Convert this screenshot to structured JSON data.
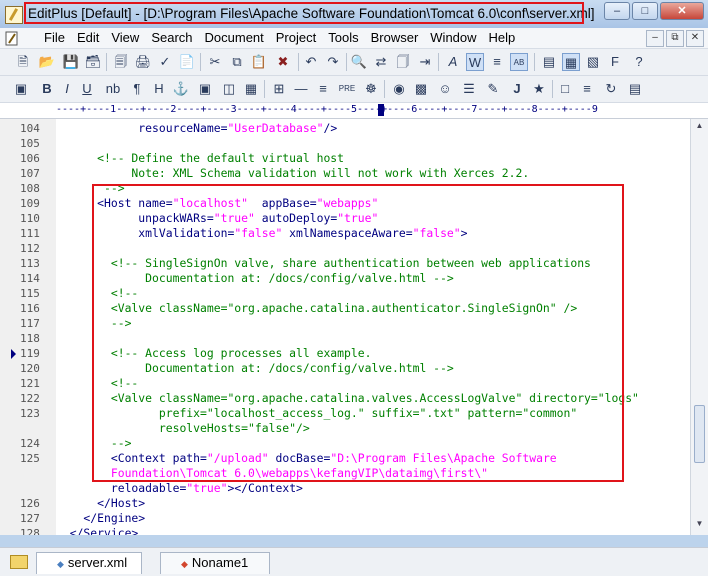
{
  "window": {
    "title": "EditPlus [Default] - [D:\\Program Files\\Apache Software Foundation\\Tomcat 6.0\\conf\\server.xml]"
  },
  "menu": [
    "File",
    "Edit",
    "View",
    "Search",
    "Document",
    "Project",
    "Tools",
    "Browser",
    "Window",
    "Help"
  ],
  "toolbar2": {
    "text_labels": [
      "B",
      "I",
      "U",
      "nb",
      "¶",
      "H",
      "J"
    ]
  },
  "ruler": "----+----1----+----2----+----3----+----4----+----5----+----6----+----7----+----8----+----9",
  "editor": {
    "lines": [
      {
        "n": "104",
        "parts": [
          {
            "t": "            ",
            "c": "txt"
          },
          {
            "t": "resourceName=",
            "c": "tag"
          },
          {
            "t": "\"UserDatabase\"",
            "c": "str"
          },
          {
            "t": "/>",
            "c": "tag"
          }
        ]
      },
      {
        "n": "105",
        "parts": []
      },
      {
        "n": "106",
        "parts": [
          {
            "t": "      <!-- Define the default virtual host",
            "c": "cm"
          }
        ]
      },
      {
        "n": "107",
        "parts": [
          {
            "t": "           Note: XML Schema validation will not work with Xerces 2.2.",
            "c": "cm"
          }
        ]
      },
      {
        "n": "108",
        "parts": [
          {
            "t": "       -->",
            "c": "cm"
          }
        ]
      },
      {
        "n": "109",
        "parts": [
          {
            "t": "      <Host ",
            "c": "tag"
          },
          {
            "t": "name=",
            "c": "tag"
          },
          {
            "t": "\"localhost\"",
            "c": "str"
          },
          {
            "t": "  appBase=",
            "c": "tag"
          },
          {
            "t": "\"webapps\"",
            "c": "str"
          }
        ]
      },
      {
        "n": "110",
        "parts": [
          {
            "t": "            unpackWARs=",
            "c": "tag"
          },
          {
            "t": "\"true\"",
            "c": "str"
          },
          {
            "t": " autoDeploy=",
            "c": "tag"
          },
          {
            "t": "\"true\"",
            "c": "str"
          }
        ]
      },
      {
        "n": "111",
        "parts": [
          {
            "t": "            xmlValidation=",
            "c": "tag"
          },
          {
            "t": "\"false\"",
            "c": "str"
          },
          {
            "t": " xmlNamespaceAware=",
            "c": "tag"
          },
          {
            "t": "\"false\"",
            "c": "str"
          },
          {
            "t": ">",
            "c": "tag"
          }
        ]
      },
      {
        "n": "112",
        "parts": []
      },
      {
        "n": "113",
        "parts": [
          {
            "t": "        <!-- SingleSignOn valve, share authentication between web applications",
            "c": "cm"
          }
        ]
      },
      {
        "n": "114",
        "parts": [
          {
            "t": "             Documentation at: /docs/config/valve.html -->",
            "c": "cm"
          }
        ]
      },
      {
        "n": "115",
        "parts": [
          {
            "t": "        <!--",
            "c": "cm"
          }
        ]
      },
      {
        "n": "116",
        "parts": [
          {
            "t": "        <Valve className=\"org.apache.catalina.authenticator.SingleSignOn\" />",
            "c": "cm"
          }
        ]
      },
      {
        "n": "117",
        "parts": [
          {
            "t": "        -->",
            "c": "cm"
          }
        ]
      },
      {
        "n": "118",
        "parts": []
      },
      {
        "n": "119",
        "parts": [
          {
            "t": "        <!-- Access log processes all example.",
            "c": "cm"
          }
        ]
      },
      {
        "n": "120",
        "parts": [
          {
            "t": "             Documentation at: /docs/config/valve.html -->",
            "c": "cm"
          }
        ]
      },
      {
        "n": "121",
        "parts": [
          {
            "t": "        <!--",
            "c": "cm"
          }
        ]
      },
      {
        "n": "122",
        "parts": [
          {
            "t": "        <Valve className=\"org.apache.catalina.valves.AccessLogValve\" directory=\"logs\"",
            "c": "cm"
          }
        ]
      },
      {
        "n": "123",
        "parts": [
          {
            "t": "               prefix=\"localhost_access_log.\" suffix=\".txt\" pattern=\"common\"",
            "c": "cm"
          }
        ]
      },
      {
        "n": "",
        "parts": [
          {
            "t": "               resolveHosts=\"false\"/>",
            "c": "cm"
          }
        ]
      },
      {
        "n": "124",
        "parts": [
          {
            "t": "        -->",
            "c": "cm"
          }
        ]
      },
      {
        "n": "125",
        "parts": [
          {
            "t": "        <Context ",
            "c": "tag"
          },
          {
            "t": "path=",
            "c": "tag"
          },
          {
            "t": "\"/upload\"",
            "c": "str"
          },
          {
            "t": " docBase=",
            "c": "tag"
          },
          {
            "t": "\"D:\\Program Files\\Apache Software",
            "c": "str"
          }
        ]
      },
      {
        "n": "",
        "parts": [
          {
            "t": "        Foundation\\Tomcat 6.0\\webapps\\kefangVIP\\dataimg\\first\\\"",
            "c": "str"
          }
        ]
      },
      {
        "n": "",
        "parts": [
          {
            "t": "        reloadable=",
            "c": "tag"
          },
          {
            "t": "\"true\"",
            "c": "str"
          },
          {
            "t": "></Context>",
            "c": "tag"
          }
        ]
      },
      {
        "n": "126",
        "parts": [
          {
            "t": "      </Host>",
            "c": "tag"
          }
        ]
      },
      {
        "n": "127",
        "parts": [
          {
            "t": "    </Engine>",
            "c": "tag"
          }
        ]
      },
      {
        "n": "128",
        "parts": [
          {
            "t": "  </Service>",
            "c": "tag"
          }
        ]
      }
    ]
  },
  "tabs": [
    {
      "label": "server.xml",
      "icon": "◆",
      "icon_color": "#4a7fc0"
    },
    {
      "label": "Noname1",
      "icon": "◆",
      "icon_color": "#d2462e"
    }
  ],
  "colors": {
    "highlight_border": "#e0141a",
    "comment": "#008000",
    "tag": "#000080",
    "string": "#ff00ff"
  }
}
